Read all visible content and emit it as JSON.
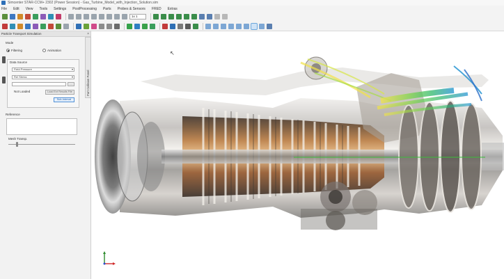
{
  "window": {
    "title": "Simcenter STAR-CCM+ 2302 (Power Session) - Gas_Turbine_Model_with_Injection_Solution.sim"
  },
  "menu": {
    "items": [
      "File",
      "Edit",
      "View",
      "Tools",
      "Settings",
      "PostProcessing",
      "Parts",
      "Probes & Sensors",
      "FRED",
      "Extras"
    ]
  },
  "toolbar": {
    "scale_value": "1x 1"
  },
  "panel": {
    "title": "Particle Transport Simulation",
    "side_tab_label": "Part Collision Panel",
    "mode_label": "Mode",
    "mode_options": [
      "Filtering",
      "Animation"
    ],
    "data_source_label": "Data Source",
    "source_select": "Field Pressure",
    "field_select": "Rel Stress",
    "not_loaded": "Not Loaded",
    "load_button": "Load Ext Results File",
    "import_button": "Sub-Interval",
    "reference_label": "Reference",
    "mesh_label": "Mesh Transp."
  },
  "colors": {
    "accent": "#4f8fd6",
    "panel_bg": "#f2f2f2"
  }
}
